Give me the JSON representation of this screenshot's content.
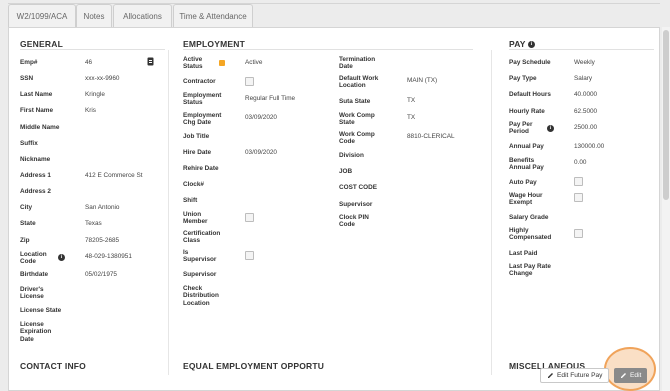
{
  "tabs": [
    "W2/1099/ACA",
    "Notes",
    "Allocations",
    "Time & Attendance"
  ],
  "general": {
    "title": "GENERAL",
    "rows": [
      {
        "label": "Emp#",
        "value": "46"
      },
      {
        "label": "SSN",
        "value": "xxx-xx-9960"
      },
      {
        "label": "Last Name",
        "value": "Kringle"
      },
      {
        "label": "First Name",
        "value": "Kris"
      },
      {
        "label": "Middle Name",
        "value": ""
      },
      {
        "label": "Suffix",
        "value": ""
      },
      {
        "label": "Nickname",
        "value": ""
      },
      {
        "label": "Address 1",
        "value": "412 E Commerce St"
      },
      {
        "label": "Address 2",
        "value": ""
      },
      {
        "label": "City",
        "value": "San Antonio"
      },
      {
        "label": "State",
        "value": "Texas"
      },
      {
        "label": "Zip",
        "value": "78205-2685"
      },
      {
        "label": "Location Code",
        "value": "48-029-1380951"
      },
      {
        "label": "Birthdate",
        "value": "05/02/1975"
      },
      {
        "label": "Driver's License",
        "value": ""
      },
      {
        "label": "License State",
        "value": ""
      },
      {
        "label": "License Expiration Date",
        "value": ""
      }
    ]
  },
  "employment": {
    "title": "EMPLOYMENT",
    "left": [
      {
        "label": "Active Status",
        "value": "Active"
      },
      {
        "label": "Contractor",
        "value": ""
      },
      {
        "label": "Employment Status",
        "value": "Regular Full Time"
      },
      {
        "label": "Employment Chg Date",
        "value": "03/09/2020"
      },
      {
        "label": "Job Title",
        "value": ""
      },
      {
        "label": "Hire Date",
        "value": "03/09/2020"
      },
      {
        "label": "Rehire Date",
        "value": ""
      },
      {
        "label": "Clock#",
        "value": ""
      },
      {
        "label": "Shift",
        "value": ""
      },
      {
        "label": "Union Member",
        "value": ""
      },
      {
        "label": "Certification Class",
        "value": ""
      },
      {
        "label": "Is Supervisor",
        "value": ""
      },
      {
        "label": "Supervisor",
        "value": ""
      },
      {
        "label": "Check Distribution Location",
        "value": ""
      }
    ],
    "right": [
      {
        "label": "Termination Date",
        "value": ""
      },
      {
        "label": "Default Work Location",
        "value": "MAIN (TX)"
      },
      {
        "label": "Suta State",
        "value": "TX"
      },
      {
        "label": "Work Comp State",
        "value": "TX"
      },
      {
        "label": "Work Comp Code",
        "value": "8810-CLERICAL"
      },
      {
        "label": "Division",
        "value": ""
      },
      {
        "label": "JOB",
        "value": ""
      },
      {
        "label": "COST CODE",
        "value": ""
      },
      {
        "label": "Supervisor",
        "value": ""
      },
      {
        "label": "Clock PIN Code",
        "value": ""
      }
    ]
  },
  "pay": {
    "title": "PAY",
    "rows": [
      {
        "label": "Pay Schedule",
        "value": "Weekly"
      },
      {
        "label": "Pay Type",
        "value": "Salary"
      },
      {
        "label": "Default Hours",
        "value": "40.0000"
      },
      {
        "label": "Hourly Rate",
        "value": "62.5000"
      },
      {
        "label": "Pay Per Period",
        "value": "2500.00"
      },
      {
        "label": "Annual Pay",
        "value": "130000.00"
      },
      {
        "label": "Benefits Annual Pay",
        "value": "0.00"
      },
      {
        "label": "Auto Pay",
        "value": ""
      },
      {
        "label": "Wage Hour Exempt",
        "value": ""
      },
      {
        "label": "Salary Grade",
        "value": ""
      },
      {
        "label": "Highly Compensated",
        "value": ""
      },
      {
        "label": "Last Paid",
        "value": ""
      },
      {
        "label": "Last Pay Rate Change",
        "value": ""
      }
    ]
  },
  "bottom_sections": [
    "CONTACT INFO",
    "EQUAL EMPLOYMENT OPPORTU",
    "MISCELLANEOUS"
  ],
  "buttons": {
    "edit_future_pay": "Edit Future Pay",
    "edit": "Edit"
  },
  "colors": {
    "status_chip": "#f5a623",
    "edit_highlight": "#f0a35a",
    "edit_button": "#8a8a8a"
  }
}
